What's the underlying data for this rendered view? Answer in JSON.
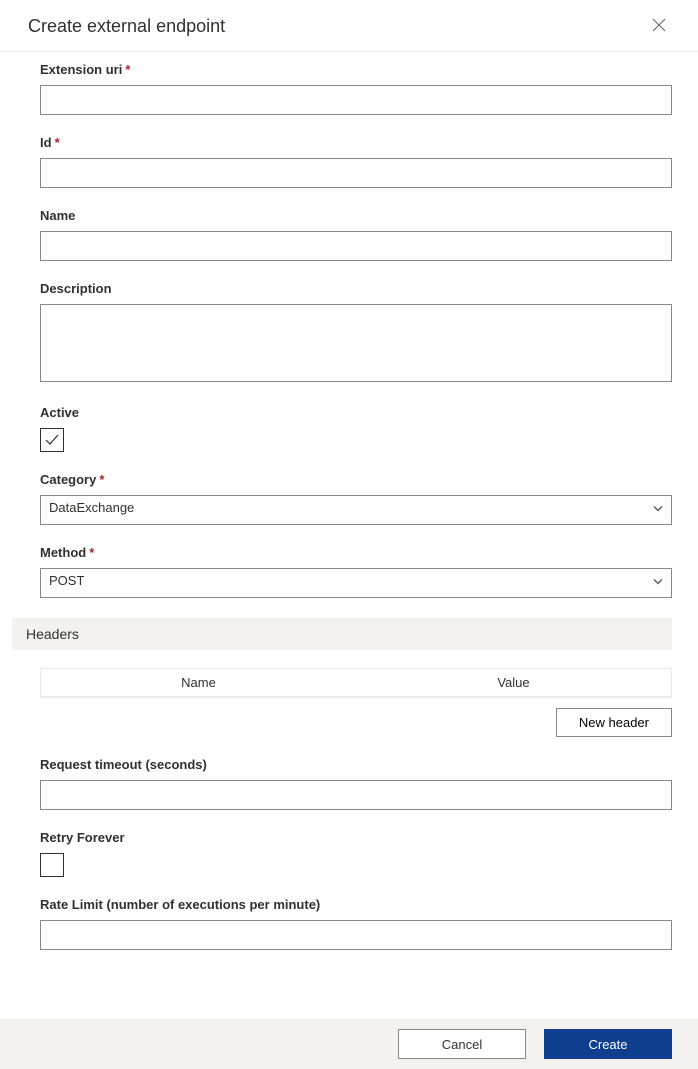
{
  "dialog": {
    "title": "Create external endpoint"
  },
  "fields": {
    "extension_uri": {
      "label": "Extension uri",
      "required": true,
      "value": ""
    },
    "id": {
      "label": "Id",
      "required": true,
      "value": ""
    },
    "name": {
      "label": "Name",
      "required": false,
      "value": ""
    },
    "description": {
      "label": "Description",
      "required": false,
      "value": ""
    },
    "active": {
      "label": "Active",
      "checked": true
    },
    "category": {
      "label": "Category",
      "required": true,
      "value": "DataExchange"
    },
    "method": {
      "label": "Method",
      "required": true,
      "value": "POST"
    },
    "request_timeout": {
      "label": "Request timeout (seconds)",
      "value": ""
    },
    "retry_forever": {
      "label": "Retry Forever",
      "checked": false
    },
    "rate_limit": {
      "label": "Rate Limit (number of executions per minute)",
      "value": ""
    }
  },
  "headers_section": {
    "title": "Headers",
    "columns": {
      "name": "Name",
      "value": "Value"
    },
    "new_header_label": "New header"
  },
  "footer": {
    "cancel": "Cancel",
    "create": "Create"
  },
  "required_marker": "*"
}
